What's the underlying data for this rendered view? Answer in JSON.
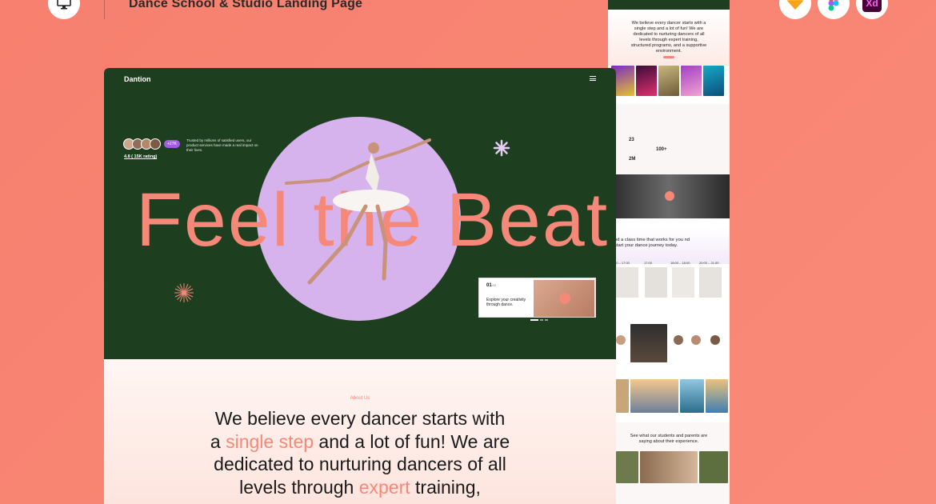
{
  "header": {
    "title": "Dance School & Studio Landing Page"
  },
  "tools": [
    "sketch-icon",
    "figma-icon",
    "xd-icon"
  ],
  "xd_label": "Xd",
  "hero": {
    "logo": "Dantion",
    "headline": "Feel the Beat",
    "badge": "+27K",
    "trusted_text": "Trusted by millions of satisfied users, our product services have made a real impact on their lives.",
    "rating": "4.8 ( 15K rating)",
    "card": {
      "number": "01",
      "total": "/05",
      "text": "Explore your creativity through dance."
    }
  },
  "about": {
    "label": "About Us",
    "line1": "We believe every dancer starts with",
    "line2_a": "a ",
    "line2_hl": "single step",
    "line2_b": " and a lot of fun! We are",
    "line3": "dedicated to nurturing dancers of all",
    "line4_a": "levels through ",
    "line4_hl": "expert",
    "line4_b": " training,"
  },
  "side": {
    "about_text": "We believe every dancer starts with a single step and a lot of fun! We are dedicated to nurturing dancers of all levels through expert training, structured programs, and a supportive environment.",
    "stats": [
      "23",
      "100+",
      "2M"
    ],
    "class_text": "nd a class time that works for you nd start your dance journey today.",
    "times": [
      "00 – 17:00",
      "17:00",
      "18:00 – 18:00",
      "20:00 – 21:00"
    ],
    "testimonial_heading": "See what our students and parents are saying about their experience."
  },
  "colors": {
    "background": "#f98573",
    "hero": "#1e3f1f",
    "accent": "#f6887a",
    "circle": "#d7b3ee"
  }
}
